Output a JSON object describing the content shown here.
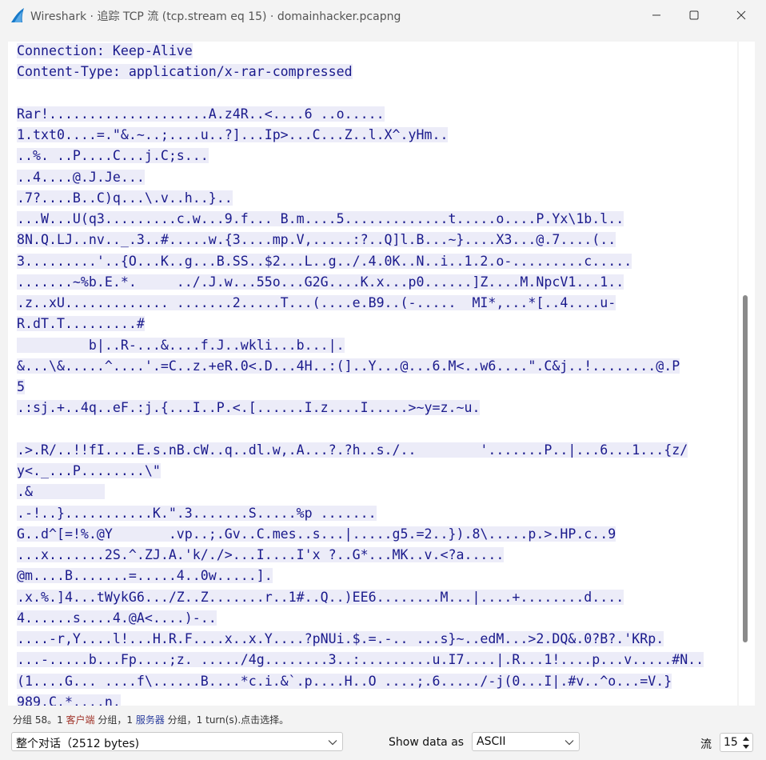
{
  "window": {
    "title": "Wireshark · 追踪 TCP 流 (tcp.stream eq 15) · domainhacker.pcapng",
    "minimize_icon": "minimize-icon",
    "maximize_icon": "maximize-icon",
    "close_icon": "close-icon",
    "app_icon": "wireshark-fin-icon"
  },
  "stream": {
    "lines": [
      "Connection: Keep-Alive",
      "Content-Type: application/x-rar-compressed",
      "",
      "Rar!....................A.z4R..<....6 ..o.....",
      "1.txt0....=.\"&.~..;....u..?]...Ip>...C...Z..l.X^.yHm..",
      "..%. ..P....C...j.C;s...",
      "..4....@.J.Je...",
      ".7?....B..C)q...\\.v..h..}..",
      "...W...U(q3.........c.w...9.f... B.m....5.............t.....o....P.Yx\\1b.l..",
      "8N.Q.LJ..nv.._.3..#.....w.{3....mp.V,.....:?..Q]l.B...~}....X3...@.7....(..",
      "3.........'..{O...K..g...B.SS..$2...L..g../.4.0K..N..i..1.2.o-.........c.....",
      ".......~%b.E.*.     ../.J.w...55o...G2G....K.x...p0......]Z....M.NpcV1...1..",
      ".z..xU............. .......2.....T...(....e.B9..(-.....  MI*,...*[..4....u-",
      "R.dT.T.........#",
      "         b|..R-...&....f.J..wkli...b...|.",
      "&...\\&.....^....'.=C..z.+eR.0<.D...4H..:(]..Y...@...6.M<..w6....\".C&j..!........@.P",
      "5",
      ".:sj.+..4q..eF.:j.{...I..P.<.[......I.z....I.....>~y=z.~u.",
      "",
      ".>.R/..!!fI....E.s.nB.cW..q..dl.w,.A...?.?h..s./..        '.......P..|...6...1...{z/",
      "y<._...P........\\\"",
      ".&         ",
      ".-!..}...........K.\".3.......S.....%p .......",
      "G..d^[=!%.@Y       .vp..;.Gv..C.mes..s...|.....g5.=2..}).8\\.....p.>.HP.c..9",
      "...x.......2S.^.ZJ.A.'k/./>...I....I'x ?..G*...MK..v.<?a.....",
      "@m....B.......=.....4..0w.....].",
      ".x.%.]4...tWykG6.../Z..Z.......r..1#..Q..)EE6........M...|....+........d....",
      "4......s....4.@A<....)-..",
      "....-r,Y....l!...H.R.F....x..x.Y....?pNUi.$.=.-.. ...s}~..edM...>2.DQ&.0?B?.'KRp.",
      "...-.....b...Fp....;z. ...../4g........3..:.........u.I7....|.R...1!....p...v.....#N..",
      "(1....G... ....f\\......B....*c.i.&`.p....H..O ....;.6...../-j(0...I|.#v..^o...=V.}",
      "989.C.*....n."
    ]
  },
  "status": {
    "prefix": "分组 58。1 ",
    "client": "客户端",
    "mid1": " 分组，1 ",
    "server": "服务器",
    "suffix": " 分组，1 turn(s).点击选择。"
  },
  "controls": {
    "conversation_select": "整个对话（2512 bytes)",
    "show_data_label": "Show data as",
    "show_data_select": "ASCII",
    "stream_label": "流",
    "stream_number": "15"
  }
}
